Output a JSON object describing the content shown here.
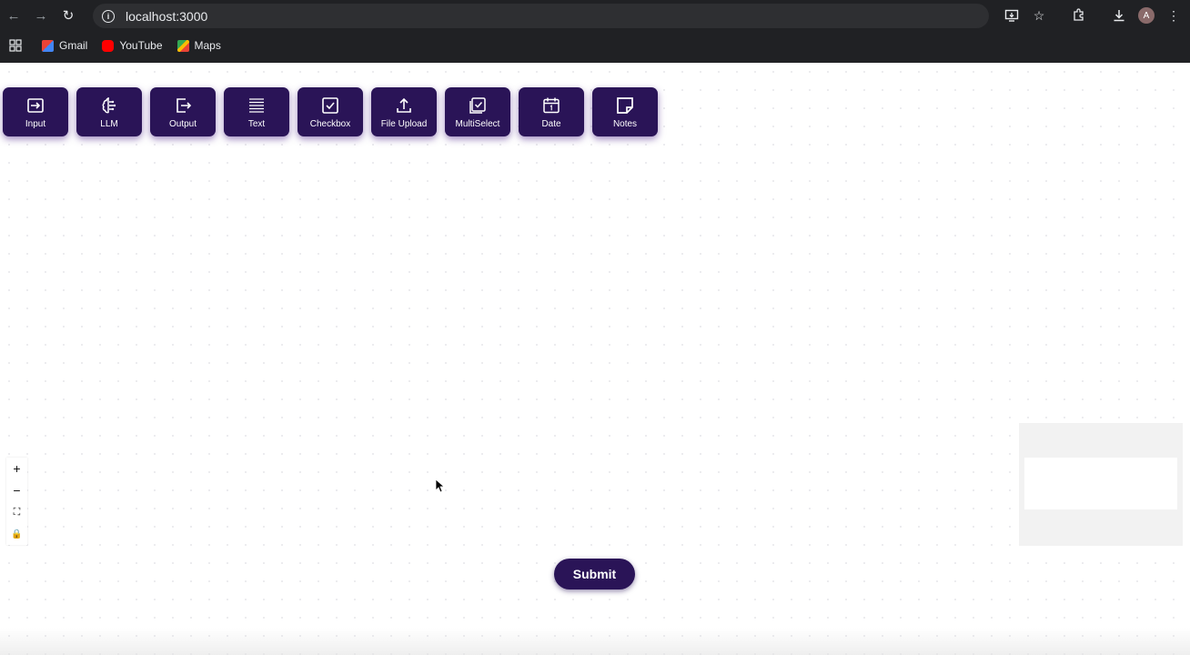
{
  "browser": {
    "url": "localhost:3000",
    "bookmarks": [
      {
        "label": "Gmail",
        "icon": "gmail-icon"
      },
      {
        "label": "YouTube",
        "icon": "youtube-icon"
      },
      {
        "label": "Maps",
        "icon": "maps-icon"
      }
    ],
    "avatar_letter": "A"
  },
  "nodes": [
    {
      "label": "Input",
      "icon": "input-icon"
    },
    {
      "label": "LLM",
      "icon": "brain-icon"
    },
    {
      "label": "Output",
      "icon": "output-icon"
    },
    {
      "label": "Text",
      "icon": "text-lines-icon"
    },
    {
      "label": "Checkbox",
      "icon": "checkbox-icon"
    },
    {
      "label": "File Upload",
      "icon": "upload-icon"
    },
    {
      "label": "MultiSelect",
      "icon": "multiselect-icon"
    },
    {
      "label": "Date",
      "icon": "calendar-icon"
    },
    {
      "label": "Notes",
      "icon": "note-icon"
    }
  ],
  "controls": {
    "zoom_in": "+",
    "zoom_out": "−",
    "fit_view": "⛶",
    "lock": "🔒"
  },
  "submit_label": "Submit",
  "colors": {
    "node_bg": "#2a1457",
    "chrome_bg": "#202124"
  }
}
